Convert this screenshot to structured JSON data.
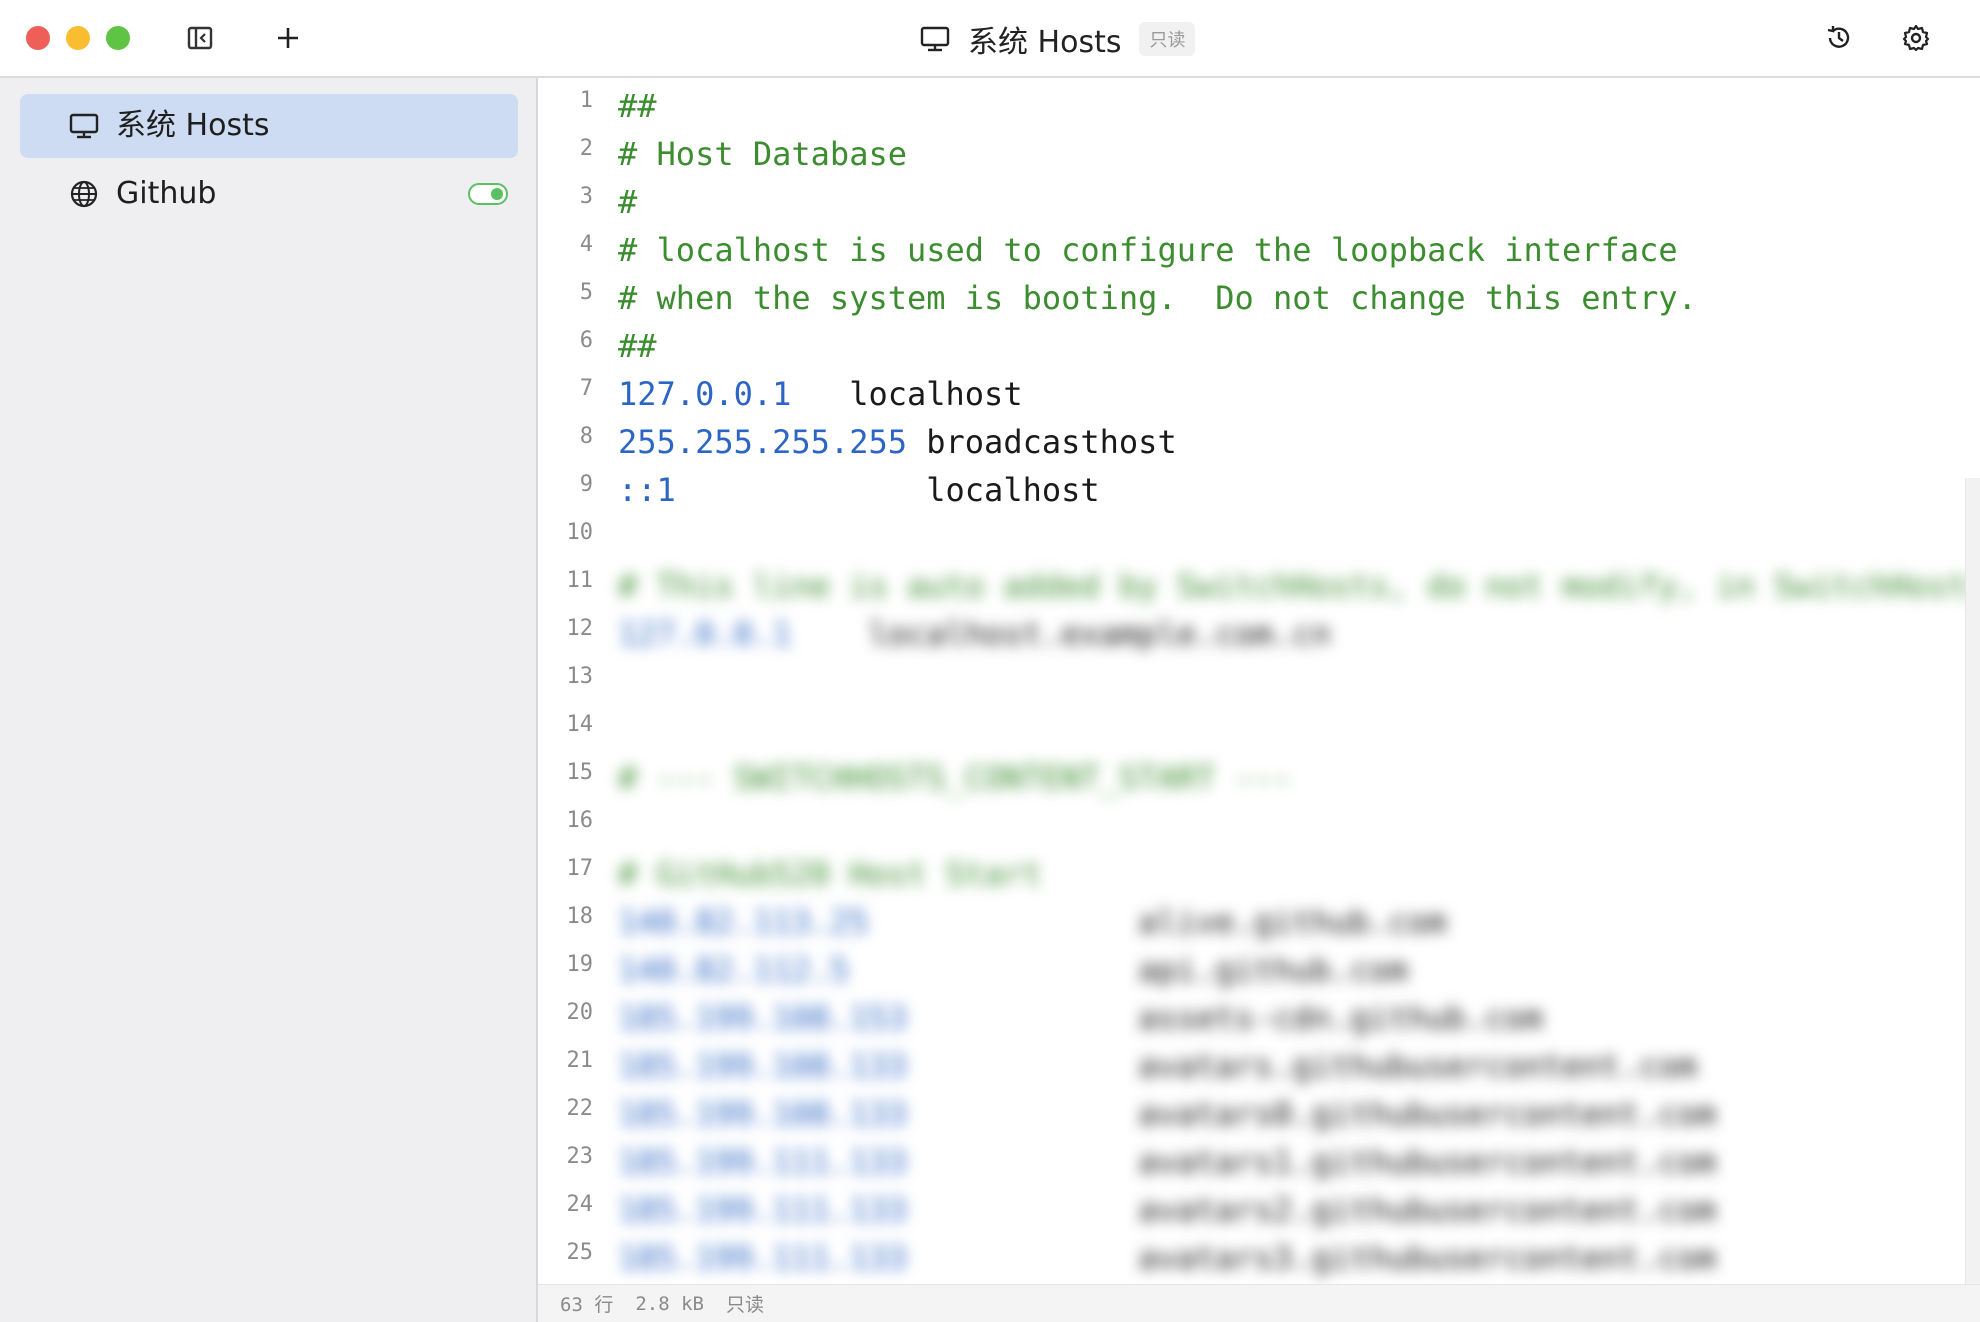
{
  "window": {
    "title": "系统 Hosts",
    "badge": "只读"
  },
  "colors": {
    "comment": "#3c8d2f",
    "ip": "#2c65c4",
    "active_item": "#cddcf2",
    "toggle_on": "#59c161"
  },
  "toolbar": {
    "sidebar_toggle_icon": "sidebar-toggle-icon",
    "add_icon": "plus-icon",
    "history_icon": "history-icon",
    "settings_icon": "gear-icon"
  },
  "sidebar": {
    "items": [
      {
        "label": "系统 Hosts",
        "icon": "monitor-icon",
        "active": true
      },
      {
        "label": "Github",
        "icon": "globe-icon",
        "toggle_on": true
      }
    ]
  },
  "editor": {
    "lines": [
      {
        "n": "1",
        "segments": [
          {
            "t": "##",
            "c": "comment"
          }
        ]
      },
      {
        "n": "2",
        "segments": [
          {
            "t": "# Host Database",
            "c": "comment"
          }
        ]
      },
      {
        "n": "3",
        "segments": [
          {
            "t": "#",
            "c": "comment"
          }
        ]
      },
      {
        "n": "4",
        "segments": [
          {
            "t": "# localhost is used to configure the loopback interface",
            "c": "comment"
          }
        ]
      },
      {
        "n": "5",
        "segments": [
          {
            "t": "# when the system is booting.  Do not change this entry.",
            "c": "comment"
          }
        ]
      },
      {
        "n": "6",
        "segments": [
          {
            "t": "##",
            "c": "comment"
          }
        ]
      },
      {
        "n": "7",
        "segments": [
          {
            "t": "127.0.0.1",
            "c": "ip"
          },
          {
            "t": "   localhost",
            "c": "host"
          }
        ]
      },
      {
        "n": "8",
        "segments": [
          {
            "t": "255.255.255.255",
            "c": "ip"
          },
          {
            "t": " broadcasthost",
            "c": "host"
          }
        ]
      },
      {
        "n": "9",
        "segments": [
          {
            "t": "::1",
            "c": "ip"
          },
          {
            "t": "             localhost",
            "c": "host"
          }
        ]
      },
      {
        "n": "10",
        "segments": []
      },
      {
        "n": "11",
        "blur": true,
        "segments": [
          {
            "t": "# This line is auto added by SwitchHosts, do not modify, in SwitchHosts",
            "c": "comment"
          }
        ]
      },
      {
        "n": "12",
        "blur": true,
        "segments": [
          {
            "t": "127.0.0.1",
            "c": "ip"
          },
          {
            "t": "    localhost.example.com.cn",
            "c": "host"
          }
        ]
      },
      {
        "n": "13",
        "segments": []
      },
      {
        "n": "14",
        "segments": []
      },
      {
        "n": "15",
        "blur": true,
        "segments": [
          {
            "t": "# --- SWITCHHOSTS_CONTENT_START ---",
            "c": "comment"
          }
        ]
      },
      {
        "n": "16",
        "segments": []
      },
      {
        "n": "17",
        "blur": true,
        "segments": [
          {
            "t": "# GitHub520 Host Start",
            "c": "comment"
          }
        ]
      },
      {
        "n": "18",
        "blur": true,
        "segments": [
          {
            "t": "140.82.113.25",
            "c": "ip"
          },
          {
            "t": "              alive.github.com",
            "c": "host"
          }
        ]
      },
      {
        "n": "19",
        "blur": true,
        "segments": [
          {
            "t": "140.82.112.5",
            "c": "ip"
          },
          {
            "t": "               api.github.com",
            "c": "host"
          }
        ]
      },
      {
        "n": "20",
        "blur": true,
        "segments": [
          {
            "t": "185.199.108.153",
            "c": "ip"
          },
          {
            "t": "            assets-cdn.github.com",
            "c": "host"
          }
        ]
      },
      {
        "n": "21",
        "blur": true,
        "segments": [
          {
            "t": "185.199.108.133",
            "c": "ip"
          },
          {
            "t": "            avatars.githubusercontent.com",
            "c": "host"
          }
        ]
      },
      {
        "n": "22",
        "blur": true,
        "segments": [
          {
            "t": "185.199.108.133",
            "c": "ip"
          },
          {
            "t": "            avatars0.githubusercontent.com",
            "c": "host"
          }
        ]
      },
      {
        "n": "23",
        "blur": true,
        "segments": [
          {
            "t": "185.199.111.133",
            "c": "ip"
          },
          {
            "t": "            avatars1.githubusercontent.com",
            "c": "host"
          }
        ]
      },
      {
        "n": "24",
        "blur": true,
        "segments": [
          {
            "t": "185.199.111.133",
            "c": "ip"
          },
          {
            "t": "            avatars2.githubusercontent.com",
            "c": "host"
          }
        ]
      },
      {
        "n": "25",
        "blur": true,
        "segments": [
          {
            "t": "185.199.111.133",
            "c": "ip"
          },
          {
            "t": "            avatars3.githubusercontent.com",
            "c": "host"
          }
        ]
      }
    ]
  },
  "status": {
    "lines": "63 行",
    "size": "2.8 kB",
    "mode": "只读"
  }
}
